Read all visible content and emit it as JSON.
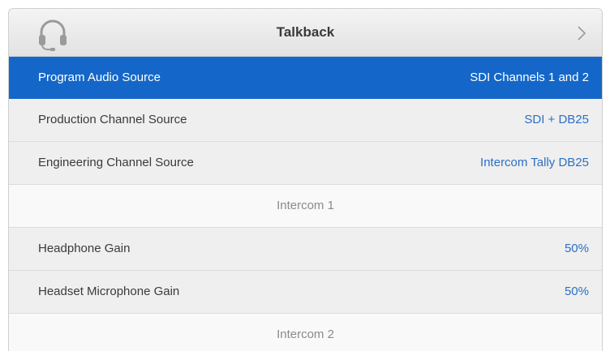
{
  "header": {
    "title": "Talkback",
    "icon": "headset-icon",
    "next_icon": "chevron-right-icon"
  },
  "rows": [
    {
      "label": "Program Audio Source",
      "value": "SDI Channels 1 and 2",
      "selected": true
    },
    {
      "label": "Production Channel Source",
      "value": "SDI + DB25"
    },
    {
      "label": "Engineering Channel Source",
      "value": "Intercom Tally DB25"
    }
  ],
  "sections": [
    {
      "title": "Intercom 1",
      "rows": [
        {
          "label": "Headphone Gain",
          "value": "50%"
        },
        {
          "label": "Headset Microphone Gain",
          "value": "50%"
        }
      ]
    },
    {
      "title": "Intercom 2"
    }
  ],
  "colors": {
    "selected": "#1467c8",
    "value_text": "#2c6fc4",
    "section_text": "#8b8b8b"
  }
}
